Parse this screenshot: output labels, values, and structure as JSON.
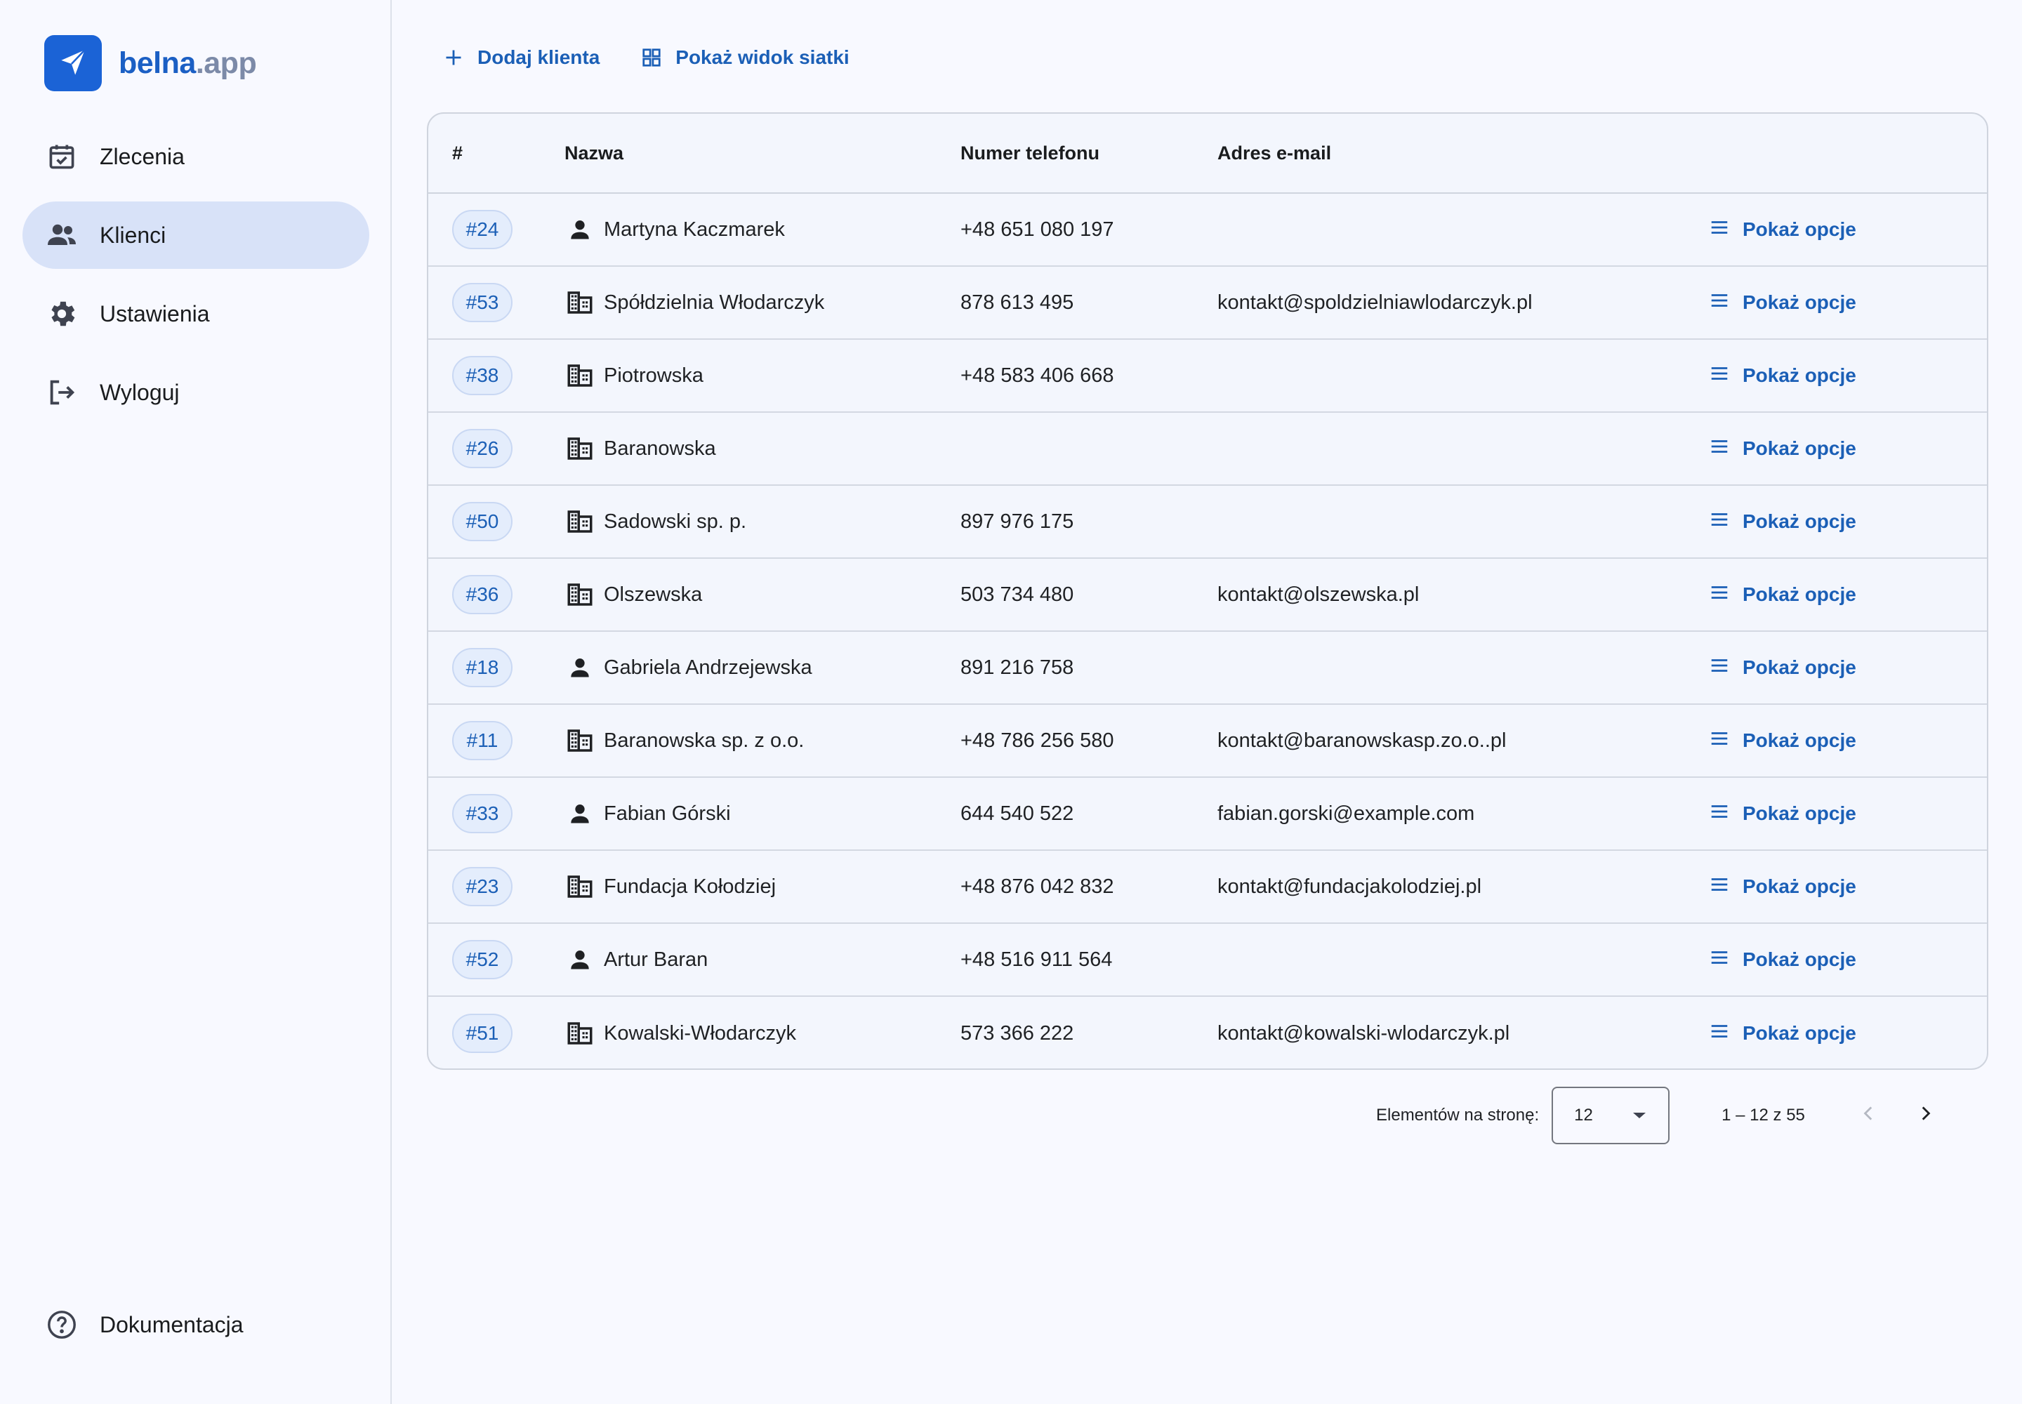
{
  "brand": {
    "name": "belna",
    "tld": ".app"
  },
  "nav": {
    "orders": "Zlecenia",
    "clients": "Klienci",
    "settings": "Ustawienia",
    "logout": "Wyloguj",
    "docs": "Dokumentacja"
  },
  "toolbar": {
    "add_client": "Dodaj klienta",
    "grid_view": "Pokaż widok siatki"
  },
  "table": {
    "headers": {
      "id": "#",
      "name": "Nazwa",
      "phone": "Numer telefonu",
      "email": "Adres e-mail"
    },
    "options_label": "Pokaż opcje",
    "rows": [
      {
        "id": "#24",
        "type": "person",
        "name": "Martyna Kaczmarek",
        "phone": "+48 651 080 197",
        "email": ""
      },
      {
        "id": "#53",
        "type": "company",
        "name": "Spółdzielnia Włodarczyk",
        "phone": "878 613 495",
        "email": "kontakt@spoldzielniawlodarczyk.pl"
      },
      {
        "id": "#38",
        "type": "company",
        "name": "Piotrowska",
        "phone": "+48 583 406 668",
        "email": ""
      },
      {
        "id": "#26",
        "type": "company",
        "name": "Baranowska",
        "phone": "",
        "email": ""
      },
      {
        "id": "#50",
        "type": "company",
        "name": "Sadowski sp. p.",
        "phone": "897 976 175",
        "email": ""
      },
      {
        "id": "#36",
        "type": "company",
        "name": "Olszewska",
        "phone": "503 734 480",
        "email": "kontakt@olszewska.pl"
      },
      {
        "id": "#18",
        "type": "person",
        "name": "Gabriela Andrzejewska",
        "phone": "891 216 758",
        "email": ""
      },
      {
        "id": "#11",
        "type": "company",
        "name": "Baranowska sp. z o.o.",
        "phone": "+48 786 256 580",
        "email": "kontakt@baranowskasp.zo.o..pl"
      },
      {
        "id": "#33",
        "type": "person",
        "name": "Fabian Górski",
        "phone": "644 540 522",
        "email": "fabian.gorski@example.com"
      },
      {
        "id": "#23",
        "type": "company",
        "name": "Fundacja Kołodziej",
        "phone": "+48 876 042 832",
        "email": "kontakt@fundacjakolodziej.pl"
      },
      {
        "id": "#52",
        "type": "person",
        "name": "Artur Baran",
        "phone": "+48 516 911 564",
        "email": ""
      },
      {
        "id": "#51",
        "type": "company",
        "name": "Kowalski-Włodarczyk",
        "phone": "573 366 222",
        "email": "kontakt@kowalski-wlodarczyk.pl"
      }
    ]
  },
  "paginator": {
    "per_page_label": "Elementów na stronę:",
    "per_page_value": "12",
    "range": "1 – 12 z 55"
  },
  "colors": {
    "accent": "#1b5fb6",
    "active_nav": "#d8e2f8",
    "logo_bg": "#1b63d6",
    "background": "#f8f9ff"
  },
  "icons": {
    "orders": "calendar-check-icon",
    "clients": "people-icon",
    "settings": "gear-icon",
    "logout": "logout-icon",
    "docs": "help-circle-icon",
    "add": "plus-icon",
    "grid": "grid-icon",
    "options": "menu-icon",
    "person": "person-icon",
    "company": "building-icon"
  }
}
